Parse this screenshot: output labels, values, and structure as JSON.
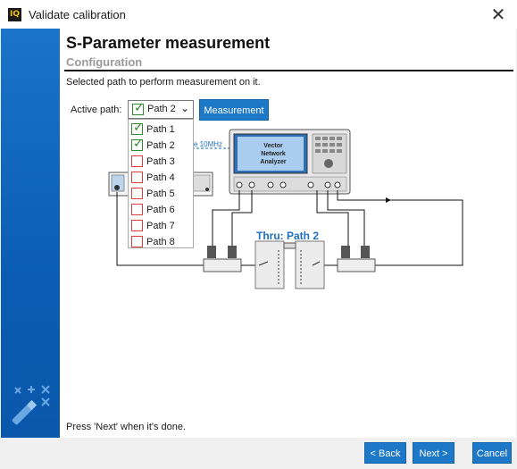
{
  "window": {
    "title": "Validate calibration",
    "app_icon_text": "IQ"
  },
  "page": {
    "heading": "S-Parameter measurement",
    "subheading": "Configuration",
    "description": "Selected path to perform measurement on it.",
    "status": "Press 'Next' when it's done."
  },
  "active_path": {
    "label": "Active path:",
    "selected": "Path 2",
    "selected_checked": true
  },
  "measurement_button": "Measurement",
  "dropdown": {
    "items": [
      {
        "label": "Path 1",
        "checked": true
      },
      {
        "label": "Path 2",
        "checked": true
      },
      {
        "label": "Path 3",
        "checked": false
      },
      {
        "label": "Path 4",
        "checked": false
      },
      {
        "label": "Path 5",
        "checked": false
      },
      {
        "label": "Path 6",
        "checked": false
      },
      {
        "label": "Path 7",
        "checked": false
      },
      {
        "label": "Path 8",
        "checked": false
      }
    ]
  },
  "diagram": {
    "vna_label": [
      "Vector",
      "Network",
      "Analyzer"
    ],
    "ref_label": "e 10MHz",
    "thru_label": "Thru: Path 2"
  },
  "footer": {
    "back": "< Back",
    "next": "Next >",
    "cancel": "Cancel"
  },
  "colors": {
    "accent": "#1e78c8",
    "sidebar": "#0a5db3",
    "checked": "#2e8b2e",
    "unchecked": "#d94040"
  }
}
